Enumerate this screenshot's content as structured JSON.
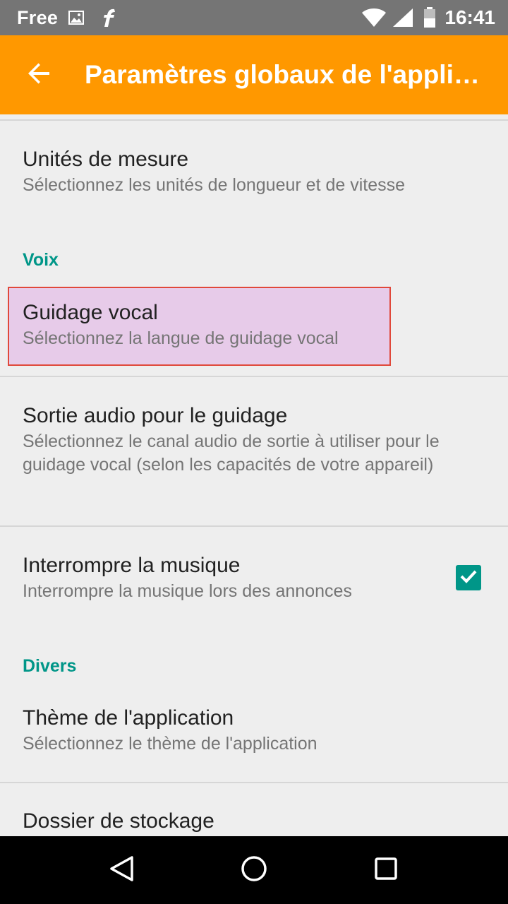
{
  "status_bar": {
    "carrier": "Free",
    "icons": [
      "image-icon",
      "flipboard-icon",
      "wifi-icon",
      "signal-icon",
      "battery-icon"
    ],
    "time": "16:41"
  },
  "app_bar": {
    "back_icon": "arrow-back-icon",
    "title": "Paramètres globaux de l'application"
  },
  "preferences": {
    "units": {
      "title": "Unités de mesure",
      "summary": "Sélectionnez les unités de longueur et de vitesse"
    },
    "category_voice": "Voix",
    "voice_guidance": {
      "title": "Guidage vocal",
      "summary": "Sélectionnez la langue de guidage vocal"
    },
    "audio_output": {
      "title": "Sortie audio pour le guidage",
      "summary": "Sélectionnez le canal audio de sortie à utiliser pour le guidage vocal (selon les capacités de votre appareil)"
    },
    "interrupt_music": {
      "title": "Interrompre la musique",
      "summary": "Interrompre la musique lors des annonces",
      "checked": true
    },
    "category_misc": "Divers",
    "app_theme": {
      "title": "Thème de l'application",
      "summary": "Sélectionnez le thème de l'application"
    },
    "storage_folder": {
      "title": "Dossier de stockage"
    }
  },
  "colors": {
    "accent": "#ff9800",
    "category": "#009688",
    "highlight_fill": "#e7cbe9",
    "highlight_border": "#e0483a"
  },
  "nav_bar": {
    "icons": [
      "back-triangle-icon",
      "home-circle-icon",
      "recents-square-icon"
    ]
  }
}
